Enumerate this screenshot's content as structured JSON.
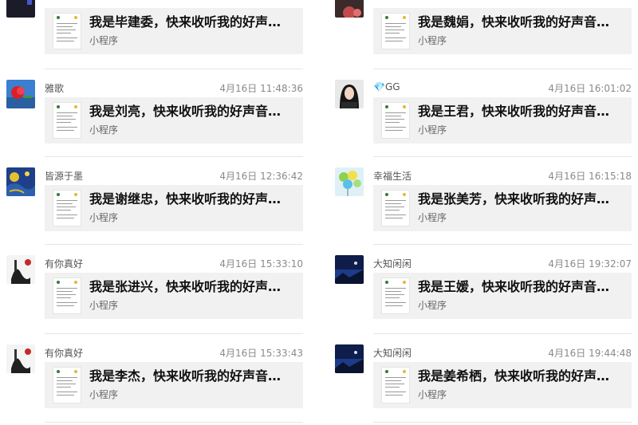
{
  "mini_program_label": "小程序",
  "left": [
    {
      "name": "",
      "time": "",
      "title": "我是毕建委，快来收听我的好声…",
      "avatar": "avatar-dark-icon"
    },
    {
      "name": "雅歌",
      "time": "4月16日 11:48:36",
      "title": "我是刘亮，快来收听我的好声音…",
      "avatar": "rose-avatar-icon"
    },
    {
      "name": "皆源于墨",
      "time": "4月16日 12:36:42",
      "title": "我是谢继忠，快来收听我的好声…",
      "avatar": "starry-night-avatar-icon"
    },
    {
      "name": "有你真好",
      "time": "4月16日 15:33:10",
      "title": "我是张进兴，快来收听我的好声…",
      "avatar": "ink-painting-avatar-icon"
    },
    {
      "name": "有你真好",
      "time": "4月16日 15:33:43",
      "title": "我是李杰，快来收听我的好声音…",
      "avatar": "ink-painting-avatar-icon"
    }
  ],
  "right": [
    {
      "name": "",
      "time": "",
      "title": "我是魏娟，快来收听我的好声音…",
      "avatar": "avatar-partial-icon"
    },
    {
      "name": "💎GG",
      "time": "4月16日 16:01:02",
      "title": "我是王君，快来收听我的好声音…",
      "avatar": "portrait-avatar-icon"
    },
    {
      "name": "幸福生活",
      "time": "4月16日 16:15:18",
      "title": "我是张美芳，快来收听我的好声…",
      "avatar": "balloons-avatar-icon"
    },
    {
      "name": "大知闲闲",
      "time": "4月16日 19:32:07",
      "title": "我是王媛，快来收听我的好声音…",
      "avatar": "night-sky-avatar-icon"
    },
    {
      "name": "大知闲闲",
      "time": "4月16日 19:44:48",
      "title": "我是姜希栖，快来收听我的好声…",
      "avatar": "night-sky-avatar-icon"
    }
  ]
}
